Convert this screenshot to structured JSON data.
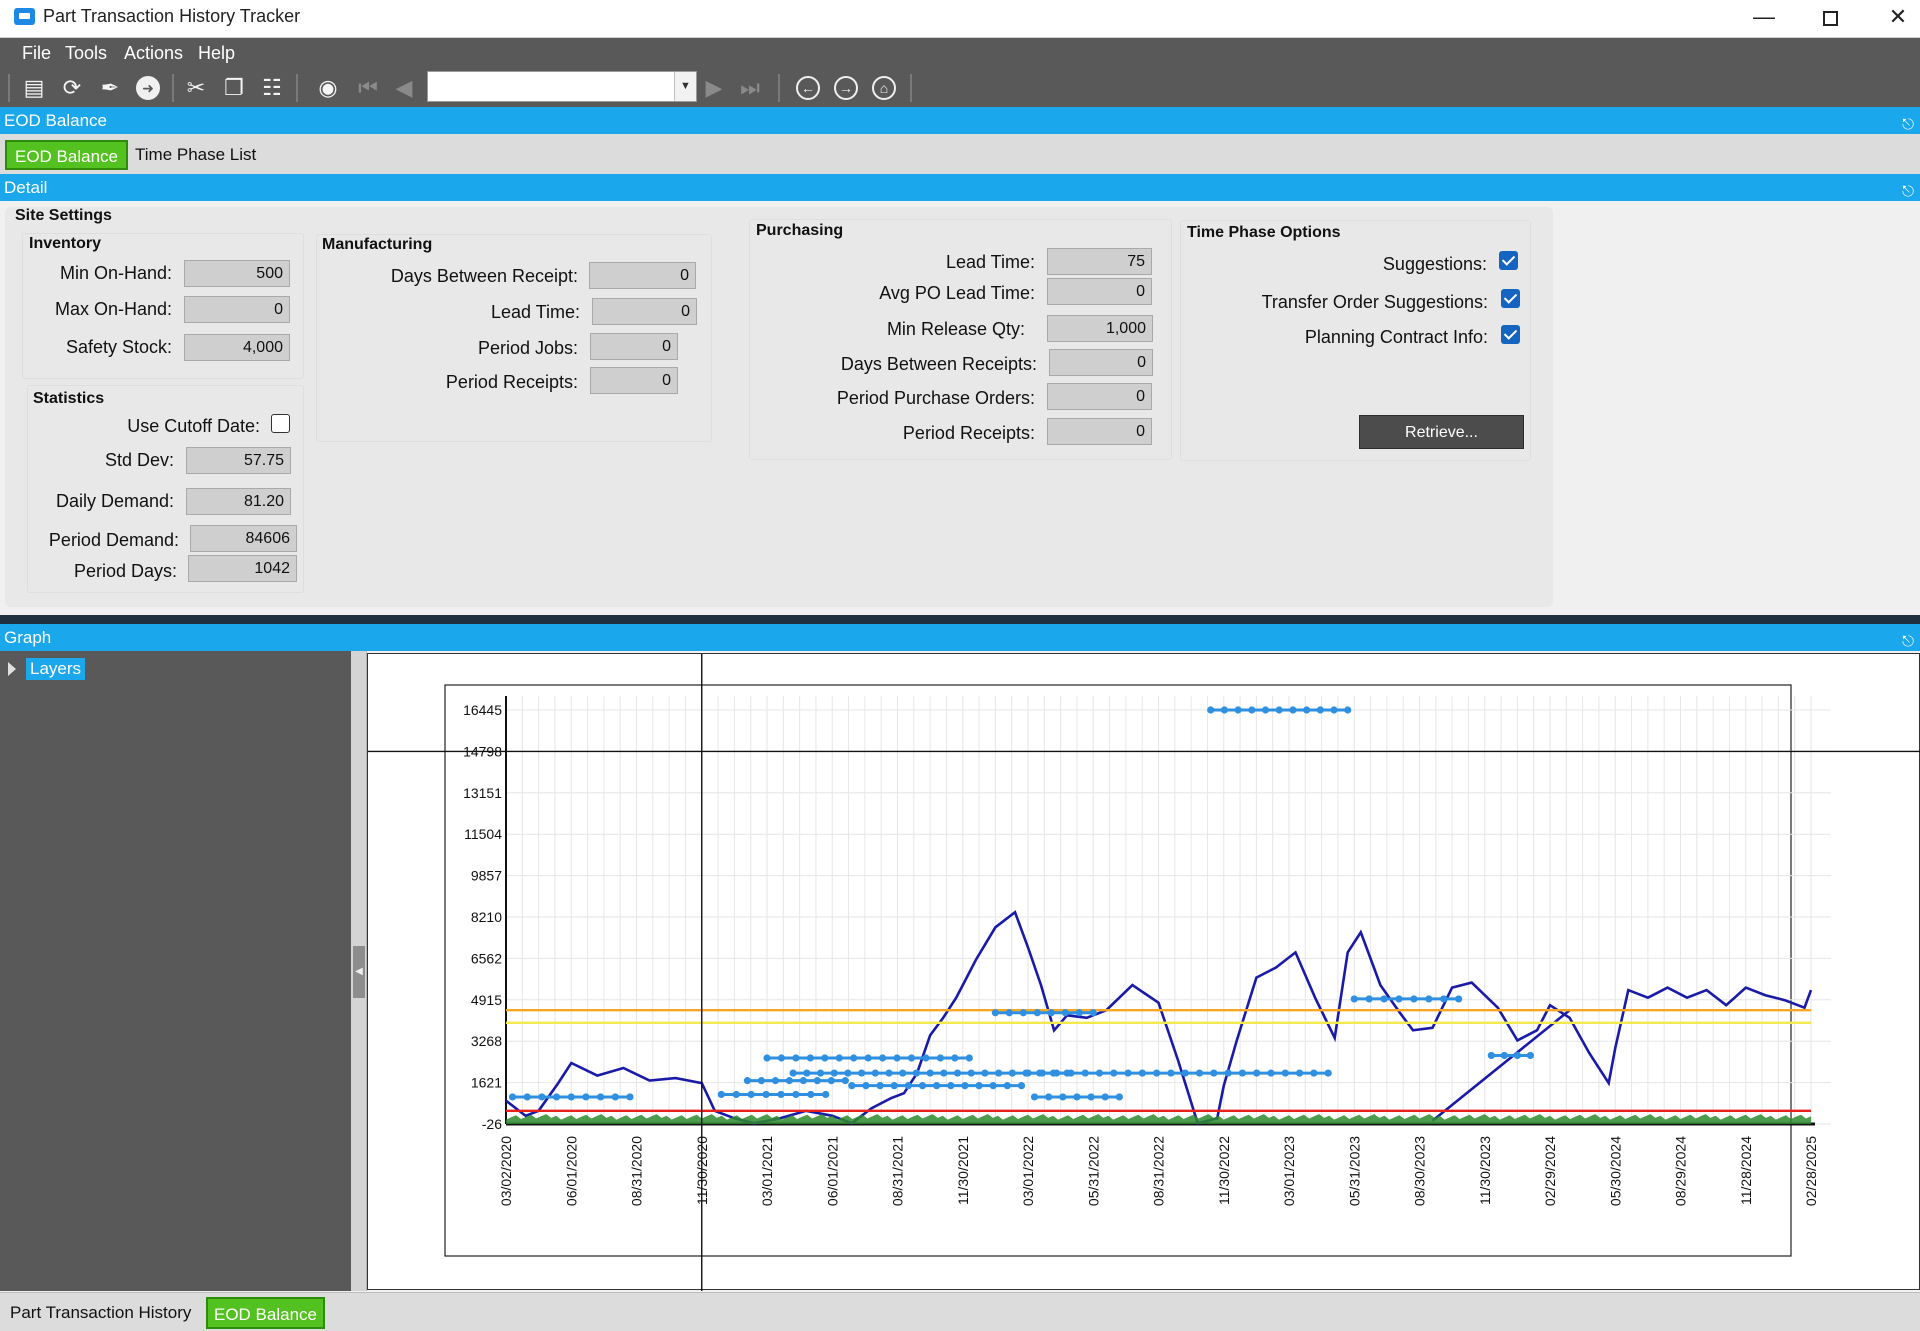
{
  "window": {
    "title": "Part Transaction History Tracker"
  },
  "menu": [
    "File",
    "Tools",
    "Actions",
    "Help"
  ],
  "toolbar": {
    "navigator_value": ""
  },
  "panels": {
    "eod_balance_header": "EOD Balance",
    "detail_header": "Detail",
    "graph_header": "Graph"
  },
  "tabs": [
    "EOD Balance",
    "Time Phase List"
  ],
  "site_settings": {
    "title": "Site Settings",
    "inventory": {
      "title": "Inventory",
      "min_on_hand_label": "Min On-Hand:",
      "min_on_hand": "500",
      "max_on_hand_label": "Max On-Hand:",
      "max_on_hand": "0",
      "safety_stock_label": "Safety Stock:",
      "safety_stock": "4,000"
    },
    "statistics": {
      "title": "Statistics",
      "use_cutoff_label": "Use Cutoff Date:",
      "use_cutoff": false,
      "std_dev_label": "Std Dev:",
      "std_dev": "57.75",
      "daily_demand_label": "Daily Demand:",
      "daily_demand": "81.20",
      "period_demand_label": "Period Demand:",
      "period_demand": "84606",
      "period_days_label": "Period Days:",
      "period_days": "1042"
    },
    "manufacturing": {
      "title": "Manufacturing",
      "days_between_receipt_label": "Days Between Receipt:",
      "days_between_receipt": "0",
      "lead_time_label": "Lead Time:",
      "lead_time": "0",
      "period_jobs_label": "Period Jobs:",
      "period_jobs": "0",
      "period_receipts_label": "Period Receipts:",
      "period_receipts": "0"
    },
    "purchasing": {
      "title": "Purchasing",
      "lead_time_label": "Lead Time:",
      "lead_time": "75",
      "avg_po_lead_time_label": "Avg PO Lead Time:",
      "avg_po_lead_time": "0",
      "min_release_qty_label": "Min Release Qty:",
      "min_release_qty": "1,000",
      "days_between_receipts_label": "Days Between Receipts:",
      "days_between_receipts": "0",
      "period_purchase_orders_label": "Period Purchase Orders:",
      "period_purchase_orders": "0",
      "period_receipts_label": "Period Receipts:",
      "period_receipts": "0"
    },
    "time_phase_options": {
      "title": "Time Phase Options",
      "suggestions_label": "Suggestions:",
      "suggestions": true,
      "transfer_order_suggestions_label": "Transfer Order Suggestions:",
      "transfer_order_suggestions": true,
      "planning_contract_info_label": "Planning Contract Info:",
      "planning_contract_info": true,
      "retrieve_label": "Retrieve..."
    }
  },
  "graph": {
    "layers_label": "Layers"
  },
  "bottom_tabs": [
    "Part Transaction History",
    "EOD Balance"
  ],
  "colors": {
    "accent_blue": "#1aa7ec",
    "active_tab_green": "#53c11f",
    "balance_line": "#1a1aa8",
    "max_line": "#f5a623",
    "safety_line": "#f2e94e",
    "min_line": "#e8201c",
    "demand_series": "#2e8b2e",
    "transaction_series": "#2f8fe0"
  },
  "chart_data": {
    "type": "line",
    "xlabel": "",
    "ylabel": "",
    "y_ticks": [
      -26,
      1621,
      3268,
      4915,
      6562,
      8210,
      9857,
      11504,
      13151,
      14798,
      16445
    ],
    "ylim": [
      -26,
      16445
    ],
    "x_ticks": [
      "03/02/2020",
      "06/01/2020",
      "08/31/2020",
      "11/30/2020",
      "03/01/2021",
      "06/01/2021",
      "08/31/2021",
      "11/30/2021",
      "03/01/2022",
      "05/31/2022",
      "08/31/2022",
      "11/30/2022",
      "03/01/2023",
      "05/31/2023",
      "08/30/2023",
      "11/30/2023",
      "02/29/2024",
      "05/30/2024",
      "08/29/2024",
      "11/28/2024",
      "02/28/2025"
    ],
    "grid": true,
    "legend": "none",
    "crosshair": {
      "x": "11/30/2020",
      "y": 14798
    },
    "series": [
      {
        "style": "line",
        "color": "#1a1aa8",
        "x": [
          0.0,
          0.3,
          0.5,
          0.8,
          1.0,
          1.4,
          1.8,
          2.2,
          2.6,
          3.0,
          3.2,
          3.5,
          3.8,
          4.2,
          4.6,
          5.0,
          5.3,
          5.6,
          5.9,
          6.1,
          6.3,
          6.5,
          6.7,
          6.9,
          7.0,
          7.2,
          7.5,
          7.8,
          8.0,
          8.2,
          8.4,
          8.6,
          8.9,
          9.2,
          9.6,
          10.0,
          10.3,
          10.6,
          10.9,
          11.0,
          11.2,
          11.5,
          11.8,
          12.1,
          12.4,
          12.7,
          12.9,
          13.1,
          13.4,
          13.7,
          13.9,
          14.2,
          14.5,
          14.8,
          15.2,
          15.5,
          15.8,
          16.0,
          16.3,
          16.6,
          16.9,
          17.0,
          17.2,
          17.5,
          17.8,
          18.1,
          18.4,
          18.7,
          19.0,
          19.3,
          19.6,
          19.9,
          20.0
        ],
        "y": [
          900,
          300,
          500,
          1600,
          2400,
          1900,
          2200,
          1700,
          1800,
          1600,
          500,
          200,
          0,
          200,
          500,
          300,
          0,
          600,
          1000,
          1200,
          2000,
          3500,
          4200,
          5000,
          5500,
          6500,
          7800,
          8400,
          7000,
          5500,
          3700,
          4300,
          4200,
          4500,
          5500,
          4800,
          2500,
          0,
          200,
          1500,
          3300,
          5800,
          6200,
          6800,
          5000,
          3400,
          6800,
          7600,
          5500,
          4400,
          3700,
          3800,
          5400,
          5600,
          4600,
          3300,
          3700,
          4700,
          4200,
          2800,
          1600,
          3000,
          5300,
          5000,
          5400,
          5000,
          5300,
          4700,
          5400,
          5100,
          4900,
          4600,
          5300
        ]
      },
      {
        "style": "line",
        "color": "#1a1aa8",
        "x": [
          14.2,
          16.3
        ],
        "y": [
          100,
          4500
        ]
      },
      {
        "style": "line",
        "color": "#f5a623",
        "x": [
          0,
          20
        ],
        "y": [
          4500,
          4500
        ]
      },
      {
        "style": "line",
        "color": "#f2e94e",
        "x": [
          0,
          20
        ],
        "y": [
          4000,
          4000
        ]
      },
      {
        "style": "line",
        "color": "#e8201c",
        "x": [
          0,
          20
        ],
        "y": [
          500,
          500
        ]
      },
      {
        "style": "area",
        "color": "#2e8b2e",
        "x": [
          0,
          20
        ],
        "y": [
          150,
          150
        ]
      },
      {
        "style": "segments",
        "color": "#2f8fe0",
        "segments": [
          {
            "x": [
              10.8,
              12.9
            ],
            "y": [
              16445,
              16445
            ]
          },
          {
            "x": [
              0.1,
              1.9
            ],
            "y": [
              1050,
              1050
            ]
          },
          {
            "x": [
              3.3,
              4.9
            ],
            "y": [
              1150,
              1150
            ]
          },
          {
            "x": [
              3.7,
              5.2
            ],
            "y": [
              1700,
              1700
            ]
          },
          {
            "x": [
              4.0,
              7.1
            ],
            "y": [
              2600,
              2600
            ]
          },
          {
            "x": [
              4.4,
              8.6
            ],
            "y": [
              2000,
              2000
            ]
          },
          {
            "x": [
              5.3,
              7.9
            ],
            "y": [
              1500,
              1500
            ]
          },
          {
            "x": [
              8.0,
              12.6
            ],
            "y": [
              2000,
              2000
            ]
          },
          {
            "x": [
              8.1,
              9.4
            ],
            "y": [
              1050,
              1050
            ]
          },
          {
            "x": [
              13.0,
              14.6
            ],
            "y": [
              4950,
              4950
            ]
          },
          {
            "x": [
              15.1,
              15.7
            ],
            "y": [
              2700,
              2700
            ]
          },
          {
            "x": [
              7.5,
              9.0
            ],
            "y": [
              4400,
              4400
            ]
          }
        ]
      }
    ]
  }
}
